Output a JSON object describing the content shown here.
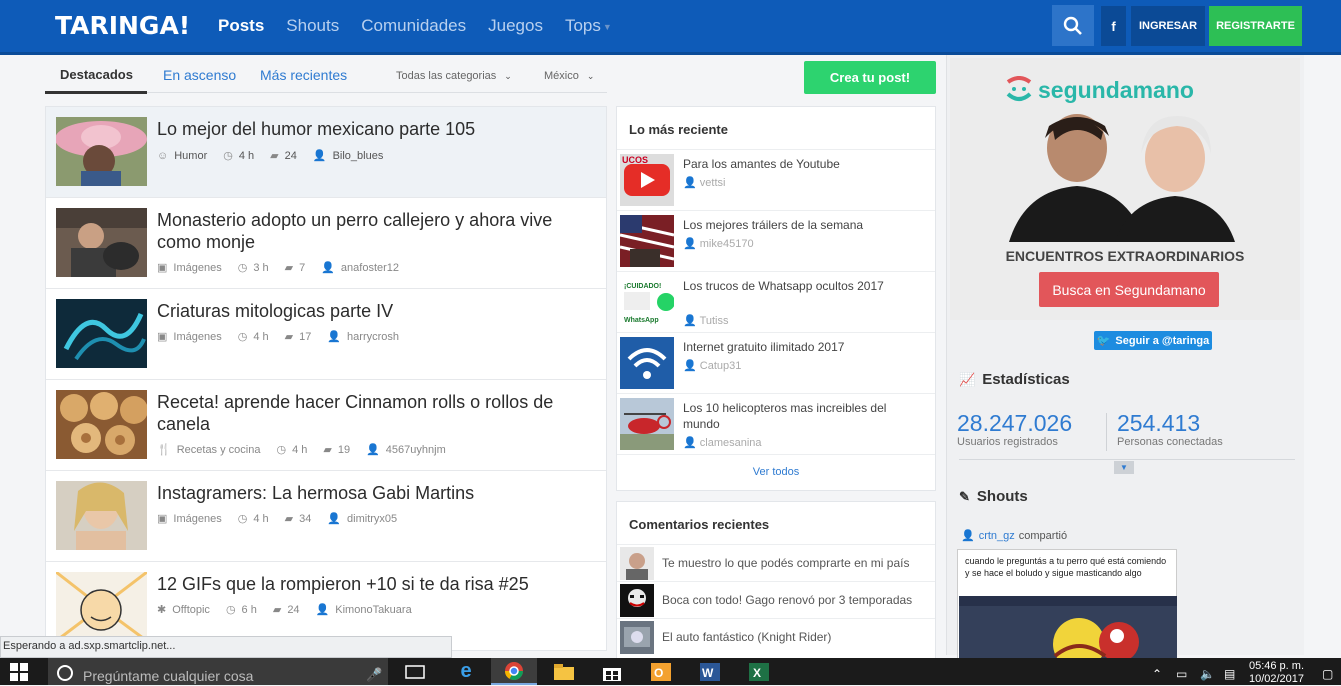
{
  "header": {
    "logo": "TARINGA!",
    "nav": [
      {
        "label": "Posts",
        "active": true
      },
      {
        "label": "Shouts",
        "active": false
      },
      {
        "label": "Comunidades",
        "active": false
      },
      {
        "label": "Juegos",
        "active": false
      },
      {
        "label": "Tops",
        "active": false
      }
    ],
    "fb_label": "f",
    "login_label": "INGRESAR",
    "register_label": "REGISTRARTE"
  },
  "tabs": {
    "items": [
      "Destacados",
      "En ascenso",
      "Más recientes"
    ],
    "category_filter": "Todas las categorias",
    "country_filter": "México"
  },
  "posts": [
    {
      "title": "Lo mejor del humor mexicano parte 105",
      "category": "Humor",
      "time": "4 h",
      "comments": "24",
      "user": "Bilo_blues"
    },
    {
      "title": "Monasterio adopto un perro callejero y ahora vive como monje",
      "category": "Imágenes",
      "time": "3 h",
      "comments": "7",
      "user": "anafoster12"
    },
    {
      "title": "Criaturas mitologicas parte IV",
      "category": "Imágenes",
      "time": "4 h",
      "comments": "17",
      "user": "harrycrosh"
    },
    {
      "title": "Receta! aprende hacer Cinnamon rolls o rollos de canela",
      "category": "Recetas y cocina",
      "time": "4 h",
      "comments": "19",
      "user": "4567uyhnjm"
    },
    {
      "title": "Instagramers: La hermosa Gabi Martins",
      "category": "Imágenes",
      "time": "4 h",
      "comments": "34",
      "user": "dimitryx05"
    },
    {
      "title": "12 GIFs que la rompieron +10 si te da risa #25",
      "category": "Offtopic",
      "time": "6 h",
      "comments": "24",
      "user": "KimonoTakuara"
    }
  ],
  "create_post_label": "Crea tu post!",
  "recent": {
    "title": "Lo más reciente",
    "items": [
      {
        "title": "Para los amantes de Youtube",
        "user": "vettsi"
      },
      {
        "title": "Los mejores tráilers de la semana",
        "user": "mike45170"
      },
      {
        "title": "Los trucos de Whatsapp ocultos 2017",
        "user": "Tutiss"
      },
      {
        "title": "Internet gratuito ilimitado 2017",
        "user": "Catup31"
      },
      {
        "title": "Los 10 helicopteros mas increibles del mundo",
        "user": "clamesanina"
      }
    ],
    "see_all": "Ver todos"
  },
  "comments": {
    "title": "Comentarios recientes",
    "items": [
      "Te muestro lo que podés comprarte en mi país",
      "Boca con todo! Gago renovó por 3 temporadas",
      "El auto fantástico (Knight Rider)"
    ]
  },
  "ad": {
    "brand": "segundamano",
    "headline": "ENCUENTROS EXTRAORDINARIOS",
    "button": "Busca en Segundamano"
  },
  "twitter_follow": "Seguir a @taringa",
  "stats": {
    "title": "Estadísticas",
    "registered_value": "28.247.026",
    "registered_label": "Usuarios registrados",
    "online_value": "254.413",
    "online_label": "Personas conectadas"
  },
  "shouts": {
    "title": "Shouts",
    "user": "crtn_gz",
    "action": "compartió",
    "text": "cuando le preguntás a tu perro qué está comiendo y se hace el boludo y sigue masticando algo"
  },
  "status_bar": "Esperando a ad.sxp.smartclip.net...",
  "taskbar": {
    "search_placeholder": "Pregúntame cualquier cosa",
    "time": "05:46 p. m.",
    "date": "10/02/2017"
  }
}
